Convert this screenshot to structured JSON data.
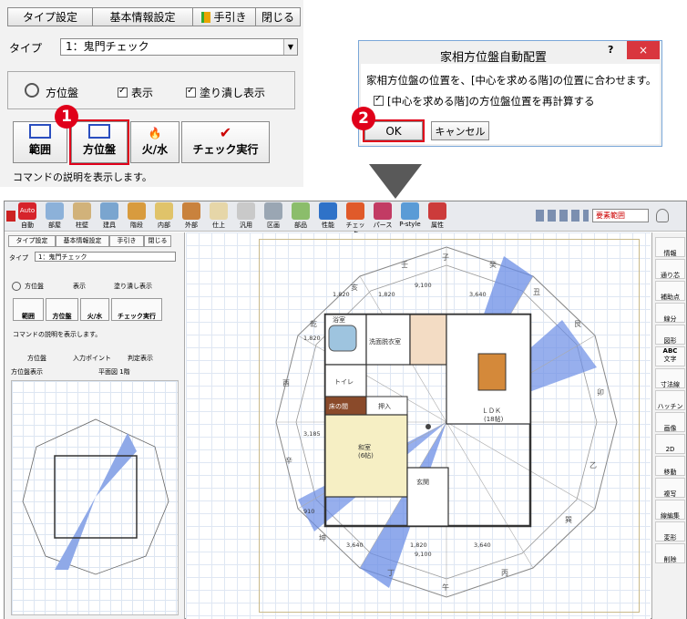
{
  "top_dialog": {
    "buttons": [
      "タイプ設定",
      "基本情報設定",
      "手引き",
      "閉じる"
    ],
    "type_label": "タイプ",
    "type_value": "1：鬼門チェック",
    "compass_label": "方位盤",
    "show_label": "表示",
    "fill_label": "塗り潰し表示",
    "cmd_range": "範囲",
    "cmd_compass": "方位盤",
    "cmd_firewater": "火/水",
    "cmd_check": "チェック実行",
    "description": "コマンドの説明を表示します。",
    "step1": "1"
  },
  "auto_dialog": {
    "title": "家相方位盤自動配置",
    "help": "?",
    "close": "×",
    "message": "家相方位盤の位置を、[中心を求める階]の位置に合わせます。",
    "checkbox_label": "[中心を求める階]の方位盤位置を再計算する",
    "ok": "OK",
    "cancel": "キャンセル",
    "step2": "2"
  },
  "app": {
    "toolbar": [
      "自動",
      "部屋",
      "柱壁",
      "建具",
      "階段",
      "内部",
      "外部",
      "仕上",
      "汎用",
      "区画",
      "部品",
      "性能",
      "チェック",
      "パース",
      "P-style",
      "属性"
    ],
    "auto_badge": "Auto",
    "range_label": "要素範囲",
    "panel_buttons": [
      "タイプ設定",
      "基本情報設定",
      "手引き",
      "閉じる"
    ],
    "type_label": "タイプ",
    "type_value": "1：鬼門チェック",
    "compass_label": "方位盤",
    "show_label": "表示",
    "fill_label": "塗り潰し表示",
    "cmd_range": "範囲",
    "cmd_compass": "方位盤",
    "cmd_firewater": "火/水",
    "cmd_check": "チェック実行",
    "description": "コマンドの説明を表示します。",
    "tabs": [
      "方位盤",
      "入力ポイント",
      "判定表示"
    ],
    "compass_show": "方位盤表示",
    "plan_label": "平面図 1階",
    "right_tools": [
      "情報",
      "通り芯",
      "補助点",
      "線分",
      "図形",
      "文字",
      "寸法線",
      "ハッチング",
      "画像",
      "2D",
      "移動",
      "複写",
      "線編集",
      "変形",
      "削除"
    ],
    "right_tool_icons": [
      "ABC"
    ]
  },
  "plan": {
    "dims_top": [
      "1,820",
      "1,820",
      "3,640",
      "9,100"
    ],
    "dims_bottom": [
      "3,640",
      "1,820",
      "3,640",
      "9,100"
    ],
    "dims_left": [
      "1,820",
      "3,185",
      "910"
    ],
    "rooms": [
      "洗面脱衣室",
      "浴室",
      "ＬＤＫ",
      "(18帖)",
      "トイレ",
      "床の間",
      "押入",
      "和室",
      "(6帖)",
      "玄関"
    ],
    "zodiac": [
      "子",
      "丑",
      "寅",
      "卯",
      "辰",
      "巳",
      "午",
      "未",
      "申",
      "酉",
      "戌",
      "亥",
      "壬",
      "癸",
      "艮",
      "乙",
      "巽",
      "丙",
      "丁",
      "坤",
      "辛",
      "乾"
    ]
  }
}
